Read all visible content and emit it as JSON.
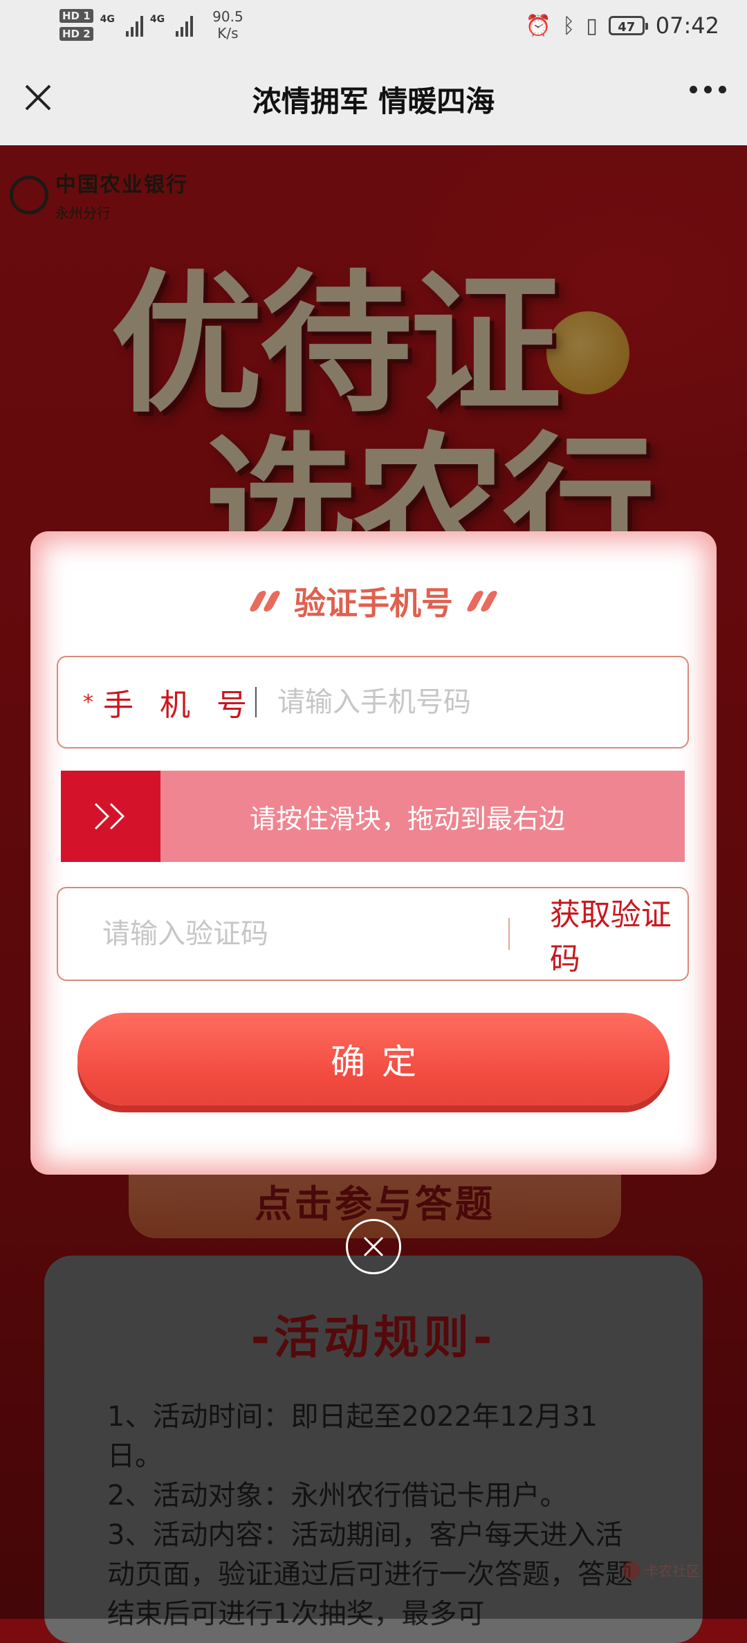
{
  "status_bar": {
    "network_1": "HD 1",
    "network_2": "HD 2",
    "signal_1": "4G",
    "signal_2": "4G",
    "speed_value": "90.5",
    "speed_unit": "K/s",
    "battery": "47",
    "time": "07:42"
  },
  "header": {
    "title": "浓情拥军 情暖四海"
  },
  "poster": {
    "bank_name": "中国农业银行",
    "bank_branch": "永州分行",
    "headline_line1": "优待证",
    "headline_line2": "选农行",
    "quiz_button": "点击参与答题"
  },
  "modal": {
    "title": "验证手机号",
    "phone_label": "手机号",
    "phone_placeholder": "请输入手机号码",
    "slider_hint": "请按住滑块，拖动到最右边",
    "code_placeholder": "请输入验证码",
    "get_code": "获取验证码",
    "confirm": "确定"
  },
  "rules": {
    "title": "-活动规则-",
    "items": [
      "1、活动时间：即日起至2022年12月31日。",
      "2、活动对象：永州农行借记卡用户。",
      "3、活动内容：活动期间，客户每天进入活动页面，验证通过后可进行一次答题，答题结束后可进行1次抽奖，最多可"
    ]
  },
  "watermark": "卡农社区",
  "colors": {
    "accent_red": "#c8181e",
    "slider_bg": "#ef8590",
    "slider_handle": "#d4132a",
    "confirm_bg": "#f24a3f"
  }
}
